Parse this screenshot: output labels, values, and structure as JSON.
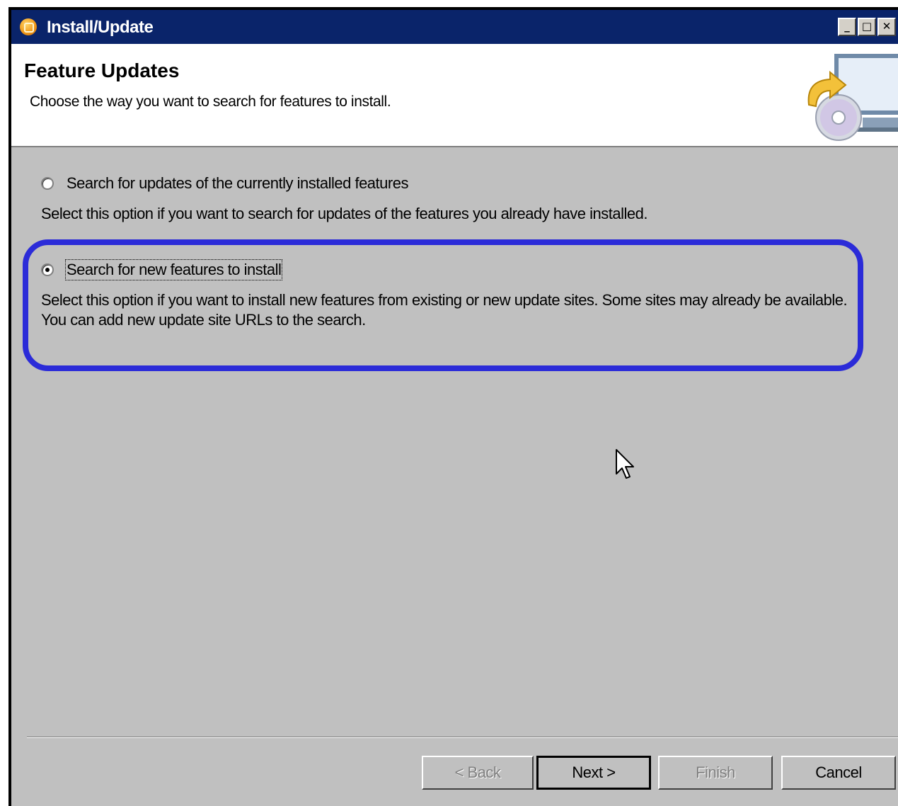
{
  "window": {
    "title": "Install/Update",
    "minimize_label": "_",
    "maximize_label": "□",
    "close_label": "✕"
  },
  "header": {
    "title": "Feature Updates",
    "description": "Choose the way you want to search for features to install."
  },
  "options": [
    {
      "label": "Search for updates of the currently installed features",
      "description": "Select this option if you want to search for updates of the features you already have installed.",
      "selected": false
    },
    {
      "label": "Search for new features to install",
      "description": "Select this option if you want to install new features from existing or new update sites. Some sites may already be available. You can add new update site URLs to the search.",
      "selected": true
    }
  ],
  "buttons": {
    "back": "< Back",
    "next": "Next >",
    "finish": "Finish",
    "cancel": "Cancel"
  },
  "colors": {
    "titlebar": "#0a246a",
    "dialog_bg": "#c0c0c0",
    "highlight": "#2b2bd8"
  }
}
